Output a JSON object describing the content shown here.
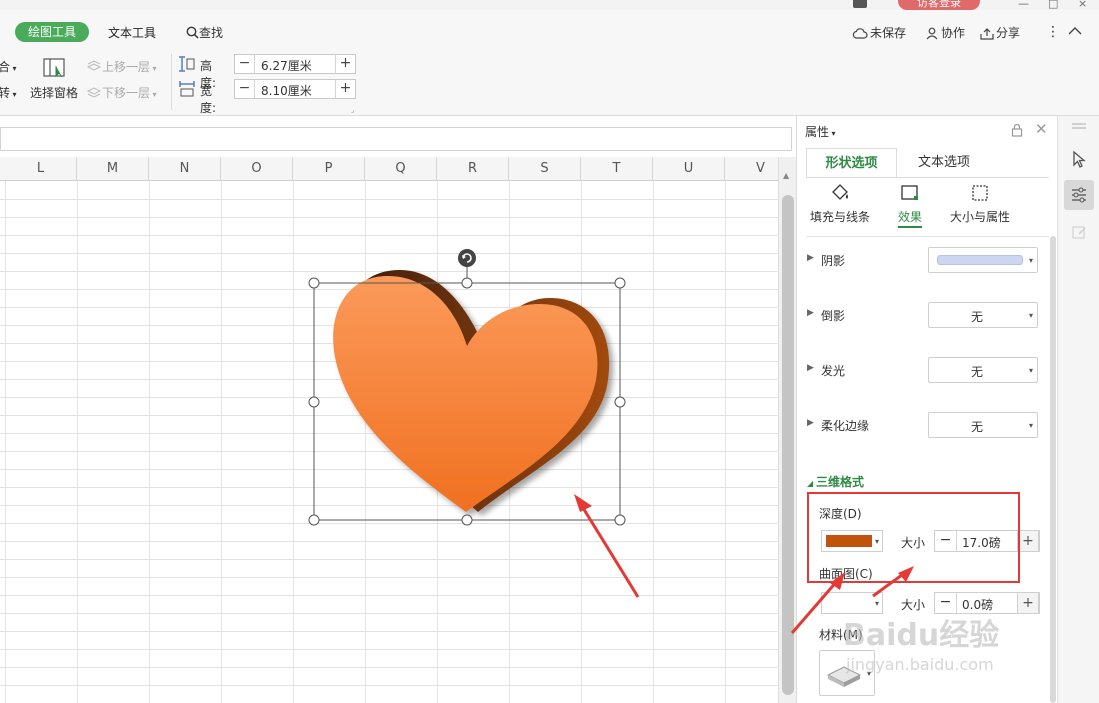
{
  "topbar": {
    "login_label": "访客登录"
  },
  "ribbon": {
    "tabs": {
      "drawing_tools": "绘图工具",
      "text_tools": "文本工具",
      "search": "查找"
    },
    "right": {
      "unsaved": "未保存",
      "collaborate": "协作",
      "share": "分享"
    },
    "left_cut": {
      "combine": "合",
      "rotate": "转"
    },
    "selection_pane": "选择窗格",
    "bring_forward": "上移一层",
    "send_backward": "下移一层",
    "height": {
      "label": "高度:",
      "value": "6.27厘米"
    },
    "width": {
      "label": "宽度:",
      "value": "8.10厘米"
    }
  },
  "sheet": {
    "columns": [
      "L",
      "M",
      "N",
      "O",
      "P",
      "Q",
      "R",
      "S",
      "T",
      "U",
      "V"
    ]
  },
  "panel": {
    "header": "属性",
    "tabs": {
      "shape": "形状选项",
      "text": "文本选项"
    },
    "subtabs": {
      "fill_line": "填充与线条",
      "effects": "效果",
      "size_props": "大小与属性"
    },
    "rows": {
      "shadow": {
        "name": "阴影"
      },
      "reflection": {
        "name": "倒影",
        "value": "无"
      },
      "glow": {
        "name": "发光",
        "value": "无"
      },
      "soft_edge": {
        "name": "柔化边缘",
        "value": "无"
      }
    },
    "three_d": {
      "title": "三维格式",
      "depth_label": "深度(D)",
      "depth_color": "#c0540c",
      "size_label": "大小",
      "depth_size": "17.0磅",
      "contour_label": "曲面图(C)",
      "contour_size": "0.0磅",
      "material_label": "材料(M)"
    }
  },
  "watermark": {
    "main": "Baidu经验",
    "sub": "jingyan.baidu.com"
  }
}
